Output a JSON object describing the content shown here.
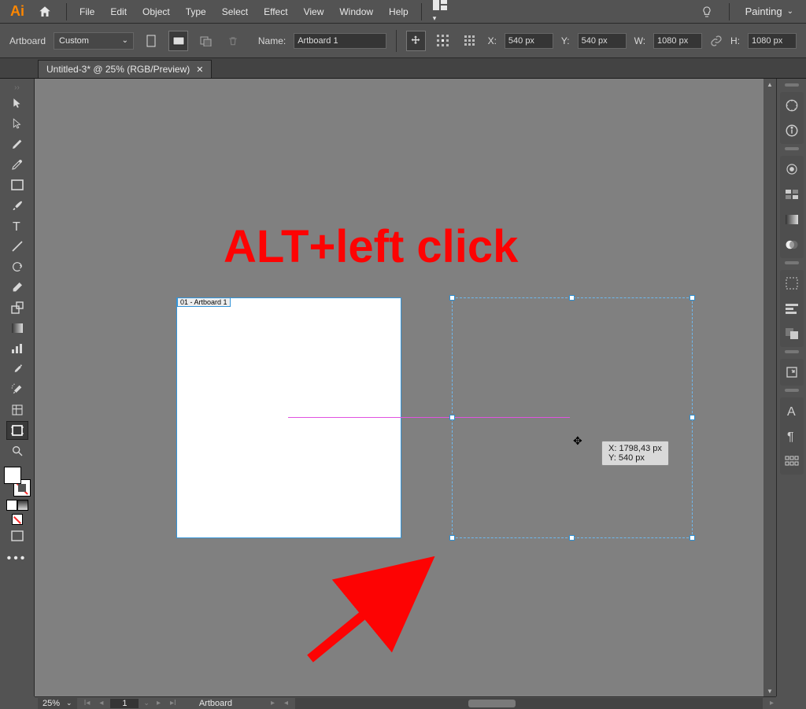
{
  "menubar": {
    "items": [
      "File",
      "Edit",
      "Object",
      "Type",
      "Select",
      "Effect",
      "View",
      "Window",
      "Help"
    ],
    "workspace": "Painting"
  },
  "optbar": {
    "mode": "Artboard",
    "preset": "Custom",
    "name_label": "Name:",
    "name_value": "Artboard 1",
    "x_label": "X:",
    "x_value": "540 px",
    "y_label": "Y:",
    "y_value": "540 px",
    "w_label": "W:",
    "w_value": "1080 px",
    "h_label": "H:",
    "h_value": "1080 px"
  },
  "doctab": {
    "title": "Untitled-3* @ 25% (RGB/Preview)"
  },
  "canvas": {
    "artboard_label": "01 - Artboard 1",
    "tooltip_x": "X: 1798,43 px",
    "tooltip_y": "Y: 540 px",
    "annotation": "ALT+left click"
  },
  "statusbar": {
    "zoom": "25%",
    "page": "1",
    "label": "Artboard"
  }
}
